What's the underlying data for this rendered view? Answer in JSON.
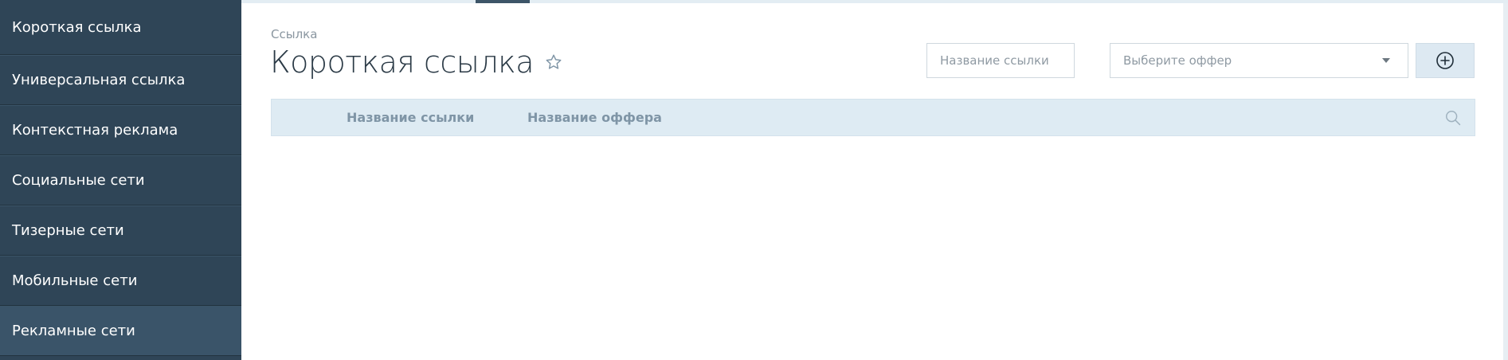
{
  "sidebar": {
    "items": [
      {
        "label": "Короткая ссылка"
      },
      {
        "label": "Универсальная ссылка"
      },
      {
        "label": "Контекстная реклама"
      },
      {
        "label": "Социальные сети"
      },
      {
        "label": "Тизерные сети"
      },
      {
        "label": "Мобильные сети"
      },
      {
        "label": "Рекламные сети"
      }
    ]
  },
  "header": {
    "breadcrumb": "Ссылка",
    "title": "Короткая ссылка"
  },
  "filters": {
    "name_placeholder": "Название ссылки",
    "offer_select": "Выберите оффер"
  },
  "table": {
    "columns": [
      "Название ссылки",
      "Название оффера"
    ]
  },
  "icons": {
    "favorite": "star-outline-icon",
    "add": "plus-circle-icon",
    "search": "search-icon",
    "dropdown": "caret-down-icon"
  },
  "colors": {
    "sidebar_bg": "#2f4557",
    "sidebar_active": "#3a5469",
    "table_header_bg": "#deebf3",
    "title": "#2b3a46"
  }
}
